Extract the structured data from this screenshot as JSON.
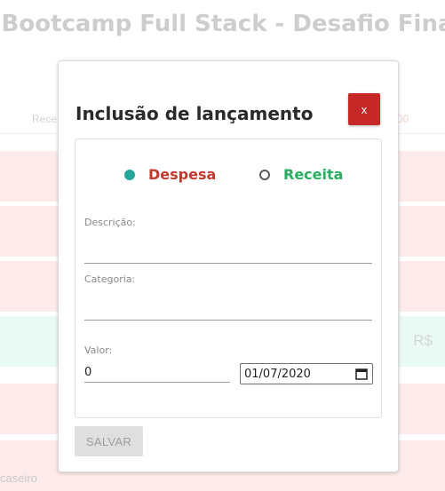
{
  "app": {
    "title": "Bootcamp Full Stack - Desafio Final",
    "summary_label_partial": "Rece",
    "summary_value_partial": "00",
    "row_amount_partial": "R$",
    "footer_text_partial": "caseiro"
  },
  "modal": {
    "title": "Inclusão de lançamento",
    "close_label": "x",
    "type_options": [
      {
        "label": "Despesa",
        "selected": true
      },
      {
        "label": "Receita",
        "selected": false
      }
    ],
    "description": {
      "label": "Descrição:",
      "value": ""
    },
    "category": {
      "label": "Categoria:",
      "value": ""
    },
    "value": {
      "label": "Valor:",
      "value": "0"
    },
    "date": {
      "value": "01/07/2020"
    },
    "save_label": "SALVAR"
  },
  "colors": {
    "close_button": "#c62828",
    "expense": "#c0392b",
    "income": "#27ae60",
    "radio_selected": "#26a69a",
    "expense_row_bg": "#fce4e4",
    "income_row_bg": "#e2f7ef"
  }
}
